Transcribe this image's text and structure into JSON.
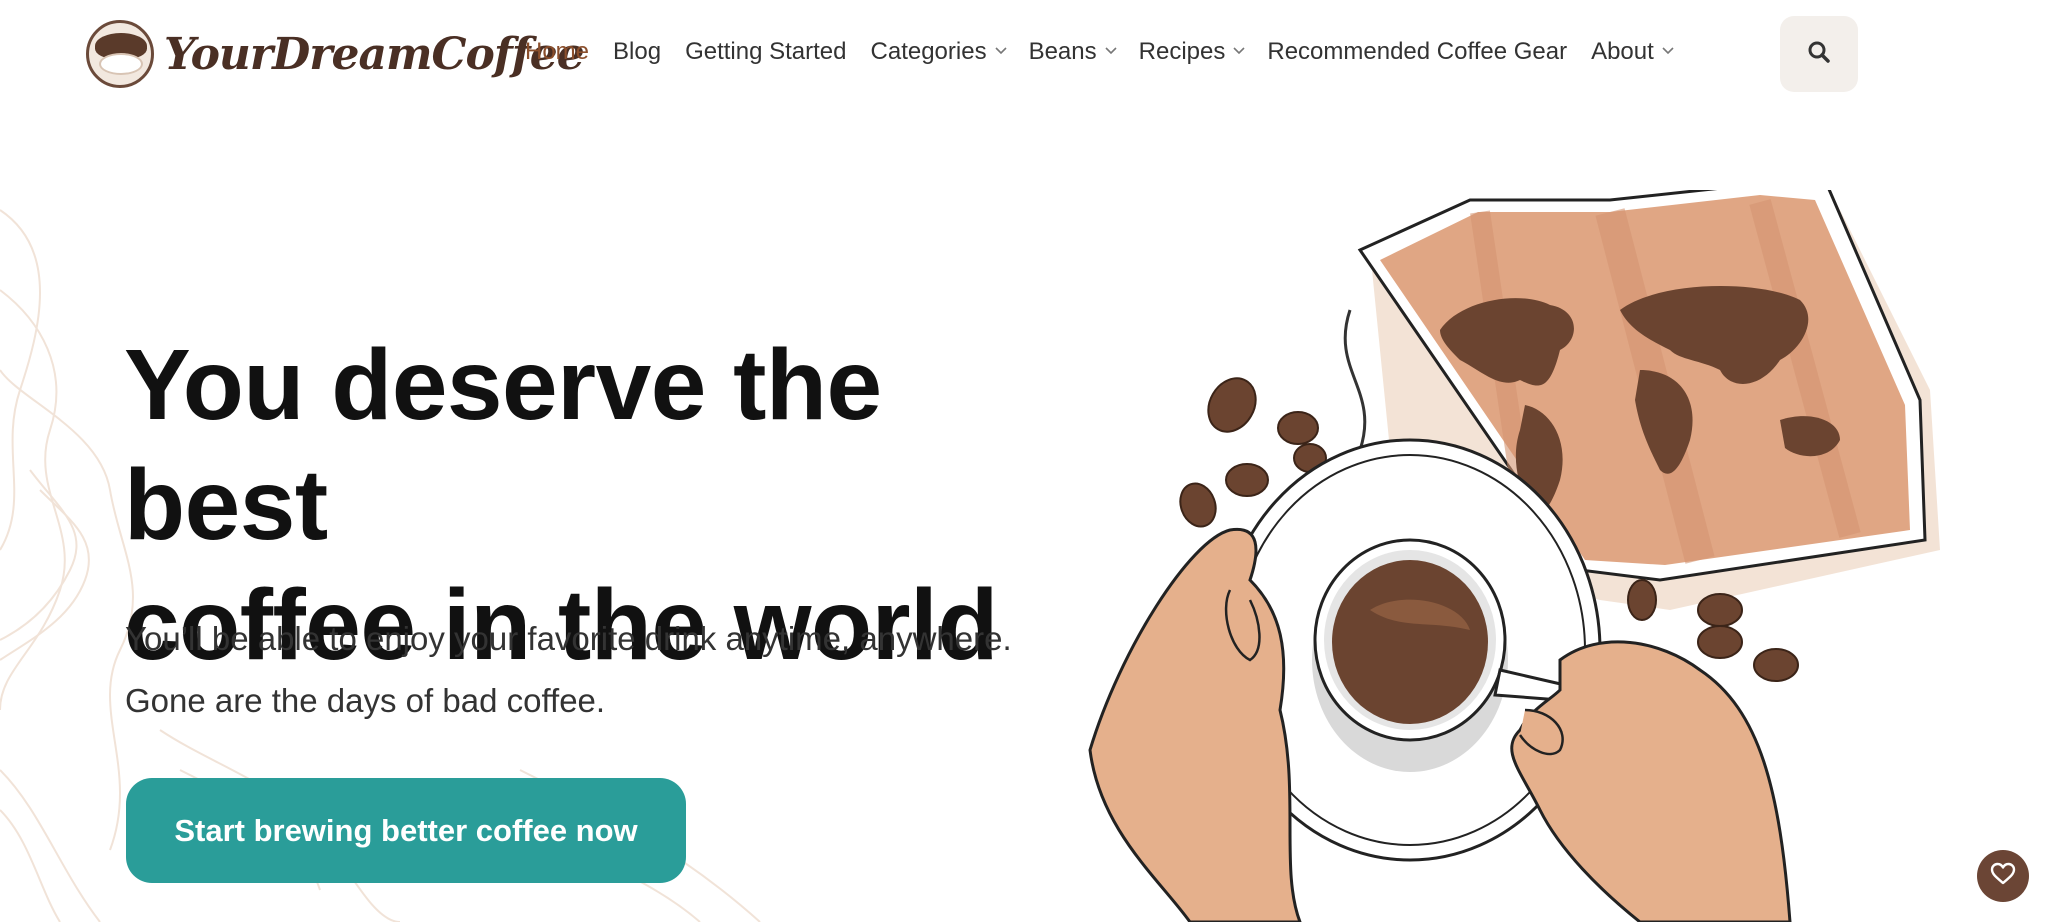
{
  "header": {
    "logo_text": "YourDreamCoffee",
    "nav": [
      {
        "label": "Home",
        "active": true,
        "dropdown": false
      },
      {
        "label": "Blog",
        "active": false,
        "dropdown": false
      },
      {
        "label": "Getting Started",
        "active": false,
        "dropdown": false
      },
      {
        "label": "Categories",
        "active": false,
        "dropdown": true
      },
      {
        "label": "Beans",
        "active": false,
        "dropdown": true
      },
      {
        "label": "Recipes",
        "active": false,
        "dropdown": true
      },
      {
        "label": "Recommended Coffee Gear",
        "active": false,
        "dropdown": false
      },
      {
        "label": "About",
        "active": false,
        "dropdown": true
      }
    ],
    "search_icon": "search-icon"
  },
  "hero": {
    "title_line1": "You deserve the best",
    "title_line2": "coffee in the world",
    "subtitle_line1": "You’ll be able to enjoy your favorite drink anytime, anywhere.",
    "subtitle_line2": "Gone are the days of bad coffee.",
    "cta_label": "Start brewing better coffee now"
  },
  "colors": {
    "accent_active": "#8b4f2c",
    "cta": "#2a9d99",
    "map": "#e0a684",
    "coffee": "#6b4430",
    "favorite_button": "#6b4535"
  },
  "icons": {
    "favorite": "heart-icon"
  }
}
